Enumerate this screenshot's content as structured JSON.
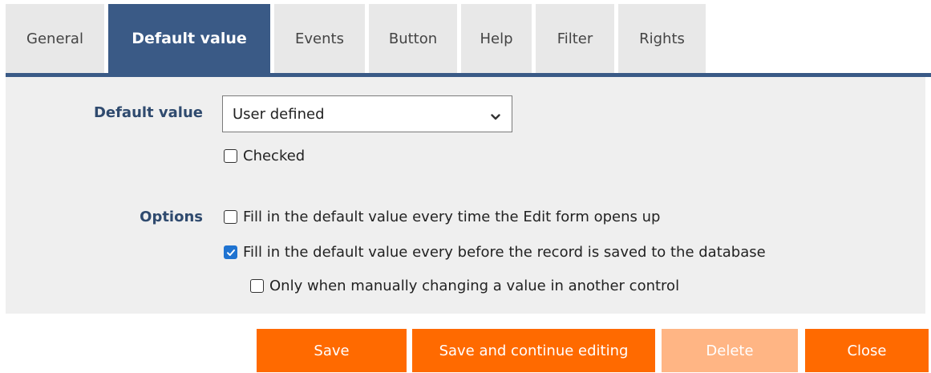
{
  "tabs": [
    {
      "label": "General"
    },
    {
      "label": "Default value"
    },
    {
      "label": "Events"
    },
    {
      "label": "Button"
    },
    {
      "label": "Help"
    },
    {
      "label": "Filter"
    },
    {
      "label": "Rights"
    }
  ],
  "active_tab": "Default value",
  "form": {
    "default_value_label": "Default value",
    "default_value_selected": "User defined",
    "checked_label": "Checked",
    "checked_value": false,
    "options_label": "Options",
    "options": [
      {
        "label": "Fill in the default value every time the Edit form opens up",
        "checked": false
      },
      {
        "label": "Fill in the default value every before the record is saved to the database",
        "checked": true
      },
      {
        "label": "Only when manually changing a value in another control",
        "checked": false
      }
    ]
  },
  "buttons": {
    "save": "Save",
    "save_continue": "Save and continue editing",
    "delete": "Delete",
    "close": "Close"
  },
  "colors": {
    "accent": "#3a5a86",
    "button": "#ff6a00",
    "button_disabled": "#ffb584",
    "checkbox_checked": "#1f73d1"
  },
  "icons": {
    "select_arrow": "chevron-down-icon",
    "checkmark": "checkmark-icon"
  }
}
